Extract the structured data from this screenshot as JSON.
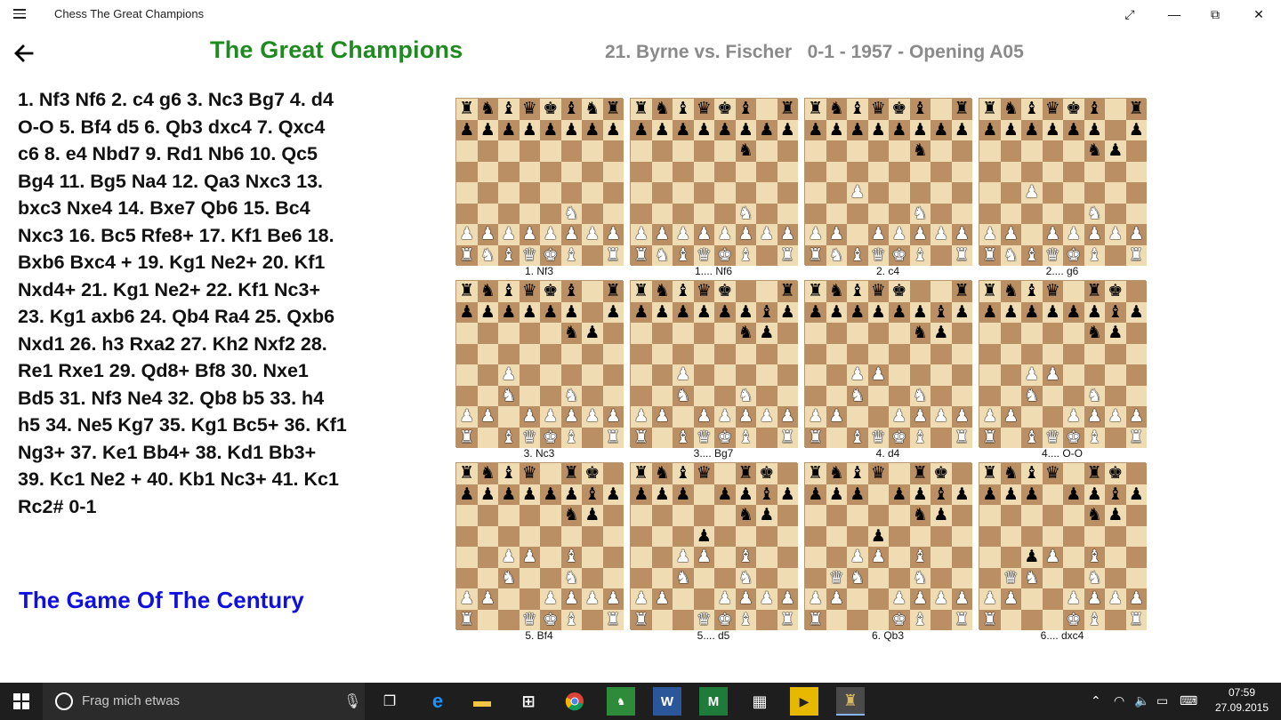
{
  "window": {
    "title": "Chess The Great Champions",
    "controls": {
      "fullscreen": "⤢",
      "minimize": "—",
      "restore": "⧉",
      "close": "✕"
    }
  },
  "header": {
    "title": "The Great Champions",
    "game_title": "21. Byrne vs. Fischer   0-1 - 1957 - Opening A05"
  },
  "moves_text": "1. Nf3 Nf6 2. c4 g6 3. Nc3 Bg7 4. d4 O-O 5. Bf4 d5 6. Qb3 dxc4 7. Qxc4 c6 8. e4 Nbd7 9. Rd1 Nb6 10. Qc5 Bg4 11. Bg5 Na4 12. Qa3 Nxc3 13. bxc3 Nxe4 14. Bxe7 Qb6 15. Bc4 Nxc3 16. Bc5 Rfe8+ 17. Kf1 Be6 18. Bxb6 Bxc4 + 19. Kg1 Ne2+ 20. Kf1 Nxd4+ 21. Kg1 Ne2+ 22. Kf1 Nc3+ 23. Kg1 axb6 24. Qb4 Ra4 25. Qxb6 Nxd1 26. h3 Rxa2 27. Kh2 Nxf2 28. Re1 Rxe1 29. Qd8+ Bf8 30. Nxe1 Bd5 31. Nf3 Ne4 32. Qb8 b5 33. h4 h5 34. Ne5 Kg7 35. Kg1 Bc5+ 36. Kf1 Ng3+ 37. Ke1 Bb4+ 38. Kd1 Bb3+ 39. Kc1 Ne2 + 40. Kb1 Nc3+ 41. Kc1 Rc2# 0-1",
  "nickname": "The Game Of The Century",
  "boards": [
    {
      "caption": "1.  Nf3",
      "fen": "rnbqkbnr/pppppppp/8/8/8/5N2/PPPPPPPP/RNBQKB1R"
    },
    {
      "caption": "1....  Nf6",
      "fen": "rnbqkb1r/pppppppp/5n2/8/8/5N2/PPPPPPPP/RNBQKB1R"
    },
    {
      "caption": "2.  c4",
      "fen": "rnbqkb1r/pppppppp/5n2/8/2P5/5N2/PP1PPPPP/RNBQKB1R"
    },
    {
      "caption": "2....  g6",
      "fen": "rnbqkb1r/pppppp1p/5np1/8/2P5/5N2/PP1PPPPP/RNBQKB1R"
    },
    {
      "caption": "3.  Nc3",
      "fen": "rnbqkb1r/pppppp1p/5np1/8/2P5/2N2N2/PP1PPPPP/R1BQKB1R"
    },
    {
      "caption": "3....  Bg7",
      "fen": "rnbqk2r/ppppppbp/5np1/8/2P5/2N2N2/PP1PPPPP/R1BQKB1R"
    },
    {
      "caption": "4.  d4",
      "fen": "rnbqk2r/ppppppbp/5np1/8/2PP4/2N2N2/PP2PPPP/R1BQKB1R"
    },
    {
      "caption": "4....  O-O",
      "fen": "rnbq1rk1/ppppppbp/5np1/8/2PP4/2N2N2/PP2PPPP/R1BQKB1R"
    },
    {
      "caption": "5.  Bf4",
      "fen": "rnbq1rk1/ppppppbp/5np1/8/2PP1B2/2N2N2/PP2PPPP/R2QKB1R"
    },
    {
      "caption": "5....  d5",
      "fen": "rnbq1rk1/ppp1ppbp/5np1/3p4/2PP1B2/2N2N2/PP2PPPP/R2QKB1R"
    },
    {
      "caption": "6.  Qb3",
      "fen": "rnbq1rk1/ppp1ppbp/5np1/3p4/2PP1B2/1QN2N2/PP2PPPP/R3KB1R"
    },
    {
      "caption": "6....  dxc4",
      "fen": "rnbq1rk1/ppp1ppbp/5np1/8/2pP1B2/1QN2N2/PP2PPPP/R3KB1R"
    }
  ],
  "taskbar": {
    "search_placeholder": "Frag mich etwas",
    "time": "07:59",
    "date": "27.09.2015"
  },
  "colors": {
    "title_green": "#1f8a1f",
    "nickname_blue": "#1010e0",
    "game_title_gray": "#8a8a8a",
    "light_square": "#efdcb2",
    "dark_square": "#b98f63"
  }
}
